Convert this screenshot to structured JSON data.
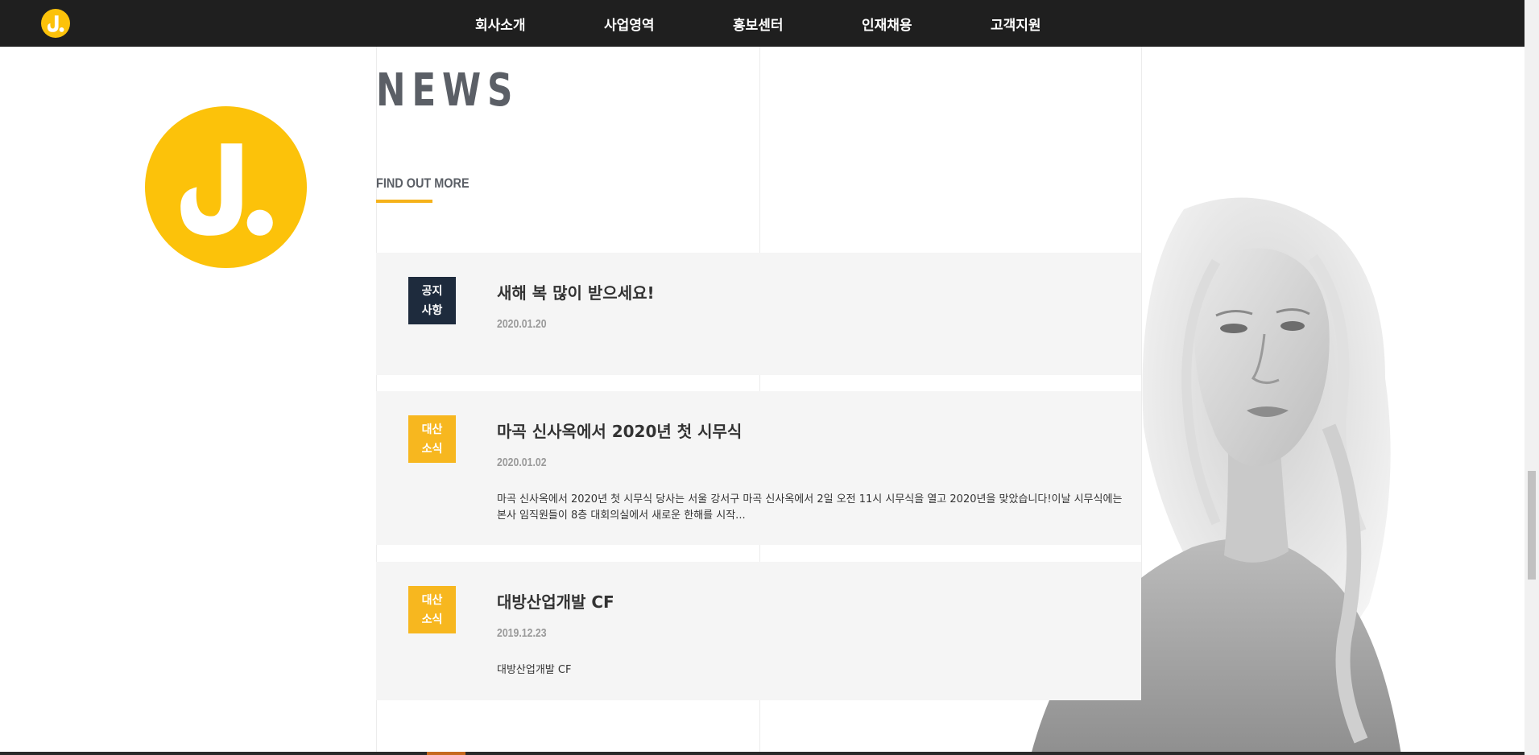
{
  "header": {
    "logo": "j-logo-icon",
    "nav": [
      "회사소개",
      "사업영역",
      "홍보센터",
      "인재채용",
      "고객지원"
    ]
  },
  "section": {
    "title": "NEWS",
    "find_more": "FIND OUT MORE"
  },
  "posts": [
    {
      "category_line1": "공지",
      "category_line2": "사항",
      "category_type": "notice",
      "title": "새해 복 많이 받으세요!",
      "date": "2020.01.20",
      "excerpt": ""
    },
    {
      "category_line1": "대산",
      "category_line2": "소식",
      "category_type": "news",
      "title": "마곡 신사옥에서 2020년 첫 시무식",
      "date": "2020.01.02",
      "excerpt": "마곡 신사옥에서 2020년 첫 시무식 당사는 서울 강서구 마곡 신사옥에서 2일 오전 11시 시무식을 열고 2020년을 맞았습니다!이날 시무식에는 본사 임직원들이 8층 대회의실에서 새로운 한해를 시작..."
    },
    {
      "category_line1": "대산",
      "category_line2": "소식",
      "category_type": "news",
      "title": "대방산업개발 CF",
      "date": "2019.12.23",
      "excerpt": "대방산업개발 CF"
    }
  ],
  "colors": {
    "nav_background": "#1f1f1f",
    "brand_yellow": "#fcc20a",
    "notice_badge": "#1e2b3d",
    "news_badge": "#f7b71f",
    "underline_accent": "#f5b21a"
  }
}
